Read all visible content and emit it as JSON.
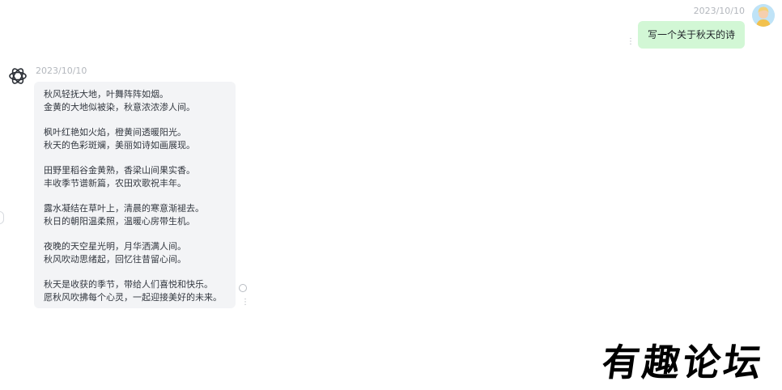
{
  "user_message": {
    "timestamp": "2023/10/10",
    "text": "写一个关于秋天的诗",
    "more_icon": "⋮"
  },
  "bot_message": {
    "timestamp": "2023/10/10",
    "more_icon": "⋮",
    "stanzas": [
      [
        "秋风轻抚大地，叶舞阵阵如烟。",
        "金黄的大地似被染，秋意浓浓渗人间。"
      ],
      [
        "枫叶红艳如火焰，橙黄间透暖阳光。",
        "秋天的色彩斑斓，美丽如诗如画展现。"
      ],
      [
        "田野里稻谷金黄熟，香梁山间果实香。",
        "丰收季节谱新篇，农田欢歌祝丰年。"
      ],
      [
        "露水凝结在草叶上，清晨的寒意渐褪去。",
        "秋日的朝阳温柔照，温暖心房带生机。"
      ],
      [
        "夜晚的天空星光明，月华洒满人间。",
        "秋风吹动思绪起，回忆往昔留心间。"
      ],
      [
        "秋天是收获的季节，带给人们喜悦和快乐。",
        "愿秋风吹拂每个心灵，一起迎接美好的未来。"
      ]
    ]
  },
  "watermark": "有趣论坛",
  "icons": {
    "user_avatar": "user-avatar",
    "bot_avatar": "openai-logo-icon",
    "more": "more-vertical-icon",
    "status": "circle-icon"
  },
  "colors": {
    "user_bubble": "#d2f7d5",
    "bot_bubble": "#f3f4f6",
    "timestamp": "#b3b7bd"
  }
}
